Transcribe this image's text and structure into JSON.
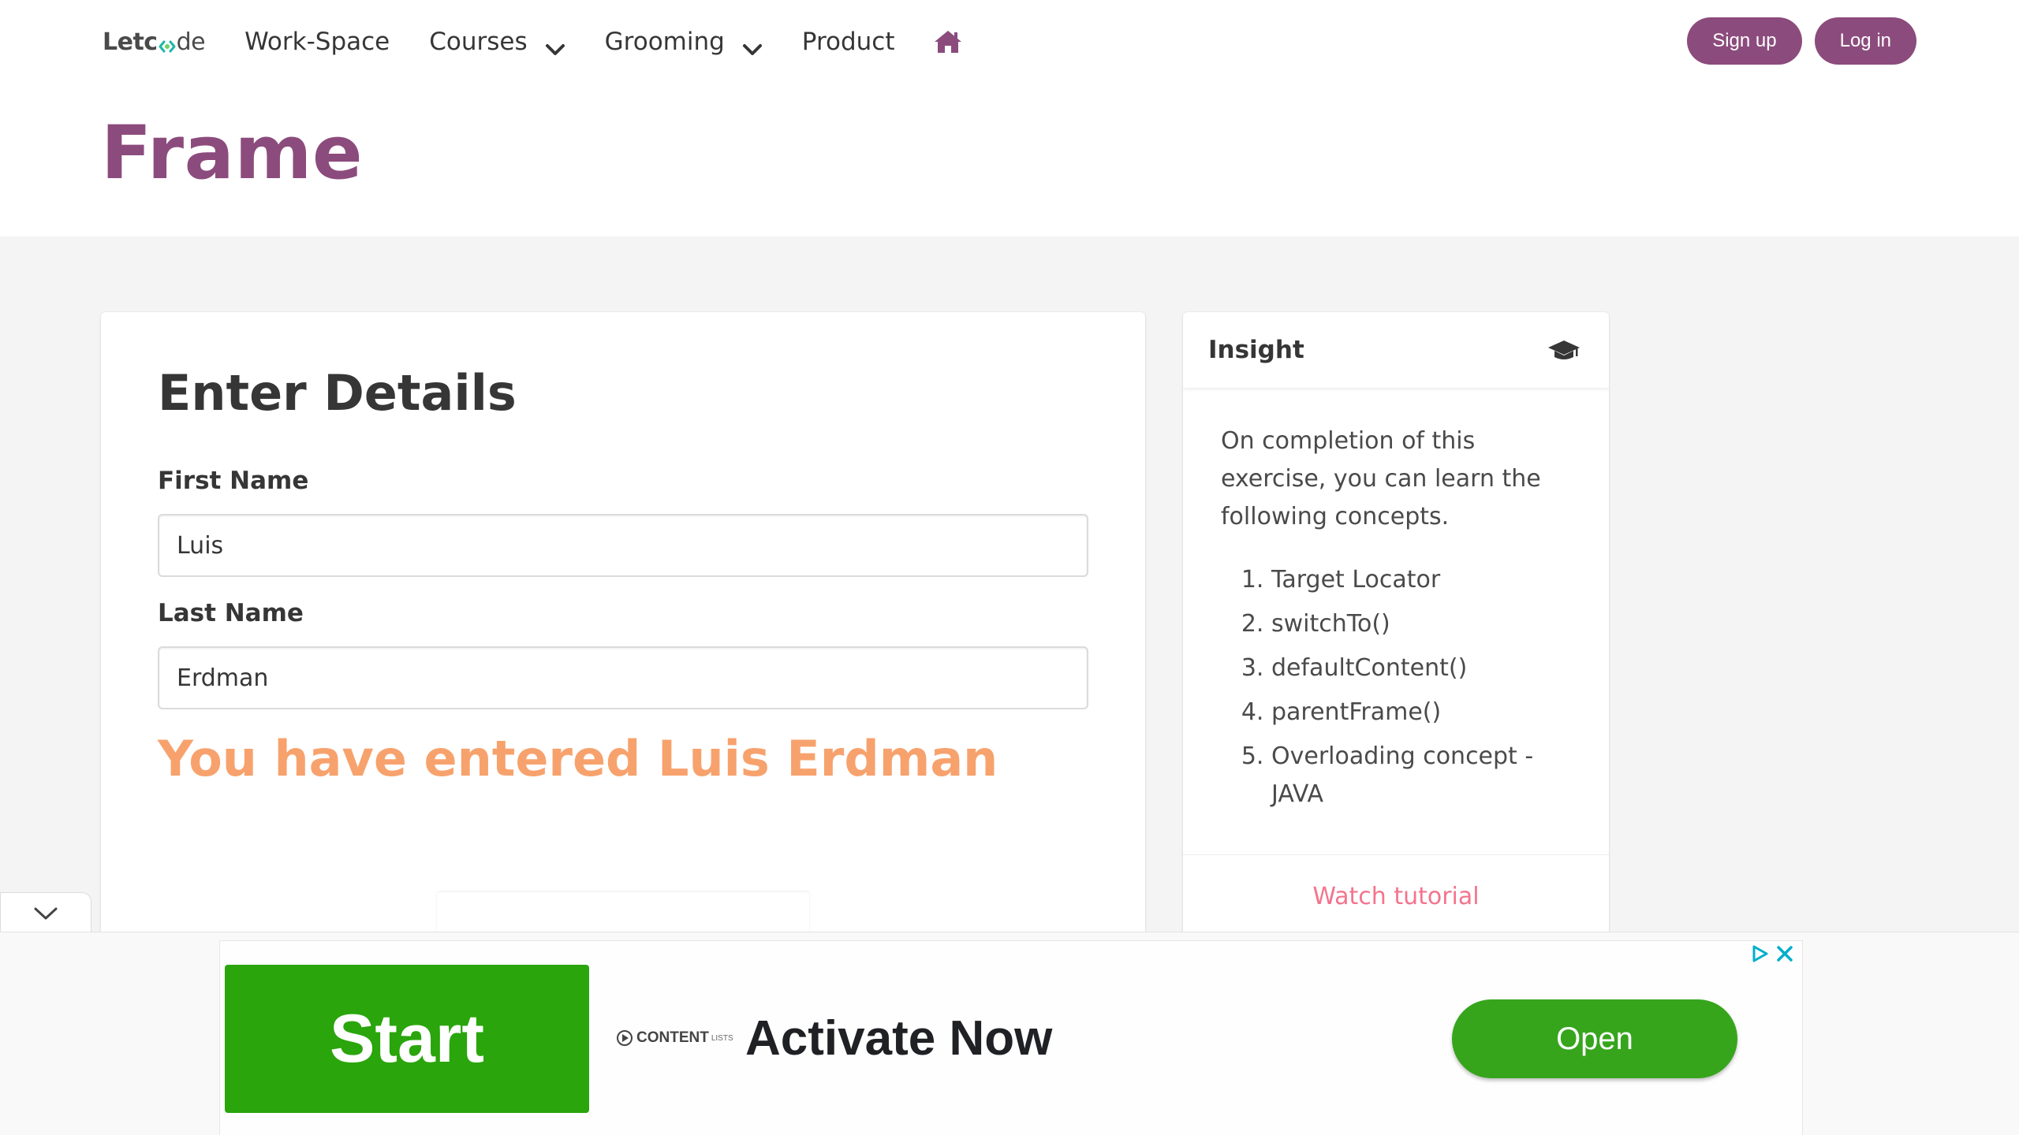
{
  "header": {
    "logo": {
      "part1": "Letc",
      "part2": "de"
    },
    "nav": [
      {
        "label": "Work-Space"
      },
      {
        "label": "Courses"
      },
      {
        "label": "Grooming"
      },
      {
        "label": "Product"
      }
    ],
    "signup_label": "Sign up",
    "login_label": "Log in",
    "page_title": "Frame"
  },
  "form": {
    "heading": "Enter Details",
    "first_name_label": "First Name",
    "first_name_value": "Luis",
    "last_name_label": "Last Name",
    "last_name_value": "Erdman",
    "result": "You have entered Luis Erdman"
  },
  "insight": {
    "title": "Insight",
    "intro": "On completion of this exercise, you can learn the following concepts.",
    "items": [
      "Target Locator",
      "switchTo()",
      "defaultContent()",
      "parentFrame()",
      "Overloading concept - JAVA"
    ],
    "footer_link": "Watch tutorial"
  },
  "ad": {
    "start_label": "Start",
    "brand": "CONTENT",
    "brand_suffix": "LISTS",
    "headline": "Activate Now",
    "open_label": "Open"
  },
  "colors": {
    "brand": "#8c4b7d",
    "result": "#f7a26d",
    "link": "#f14668",
    "ad_green": "#2aa50c"
  }
}
